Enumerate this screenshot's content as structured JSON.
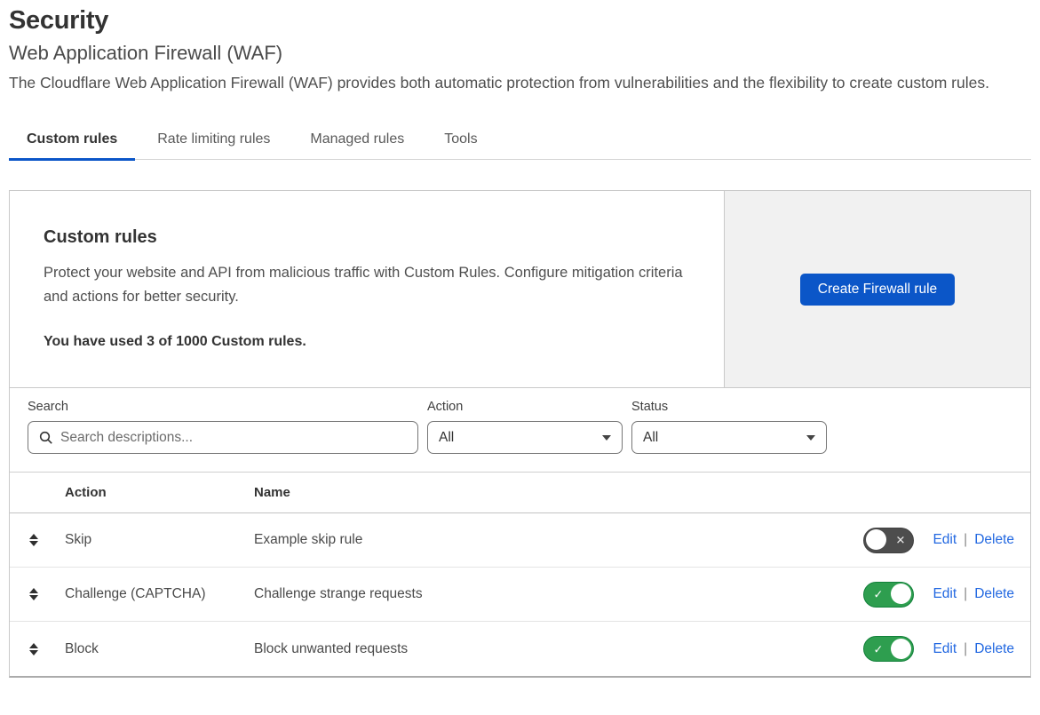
{
  "page": {
    "title": "Security",
    "subtitle": "Web Application Firewall (WAF)",
    "description": "The Cloudflare Web Application Firewall (WAF) provides both automatic protection from vulnerabilities and the flexibility to create custom rules."
  },
  "tabs": [
    {
      "label": "Custom rules",
      "active": true
    },
    {
      "label": "Rate limiting rules",
      "active": false
    },
    {
      "label": "Managed rules",
      "active": false
    },
    {
      "label": "Tools",
      "active": false
    }
  ],
  "card": {
    "title": "Custom rules",
    "description": "Protect your website and API from malicious traffic with Custom Rules. Configure mitigation criteria and actions for better security.",
    "usage": "You have used 3 of 1000 Custom rules.",
    "create_button": "Create Firewall rule"
  },
  "filters": {
    "search_label": "Search",
    "search_placeholder": "Search descriptions...",
    "action_label": "Action",
    "action_value": "All",
    "status_label": "Status",
    "status_value": "All"
  },
  "table": {
    "columns": [
      "Action",
      "Name"
    ],
    "rows": [
      {
        "action": "Skip",
        "name": "Example skip rule",
        "enabled": false
      },
      {
        "action": "Challenge (CAPTCHA)",
        "name": "Challenge strange requests",
        "enabled": true
      },
      {
        "action": "Block",
        "name": "Block unwanted requests",
        "enabled": true
      }
    ],
    "edit_label": "Edit",
    "delete_label": "Delete",
    "link_separator": "|"
  },
  "icons": {
    "toggle_on_glyph": "✓",
    "toggle_off_glyph": "✕"
  },
  "colors": {
    "accent_blue": "#0b56c8",
    "link_blue": "#2268e1",
    "toggle_on_green": "#2e9e4f",
    "toggle_off_gray": "#4d4d4d",
    "panel_gray_bg": "#f1f1f1"
  }
}
